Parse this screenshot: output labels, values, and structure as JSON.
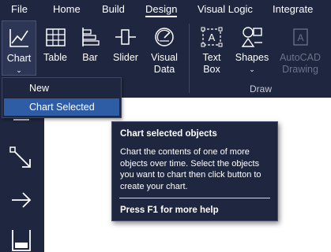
{
  "menu": {
    "tabs": [
      {
        "label": "File"
      },
      {
        "label": "Home"
      },
      {
        "label": "Build"
      },
      {
        "label": "Design",
        "active": true
      },
      {
        "label": "Visual Logic"
      },
      {
        "label": "Integrate"
      }
    ]
  },
  "ribbon": {
    "buttons": {
      "chart": "Chart",
      "table": "Table",
      "bar": "Bar",
      "slider": "Slider",
      "visual_data_line1": "Visual",
      "visual_data_line2": "Data",
      "text_box_line1": "Text",
      "text_box_line2": "Box",
      "shapes": "Shapes",
      "autocad_line1": "AutoCAD",
      "autocad_line2": "Drawing"
    },
    "groups": {
      "draw": "Draw"
    }
  },
  "dropdown": {
    "items": [
      {
        "label": "New"
      },
      {
        "label": "Chart Selected",
        "active": true
      }
    ]
  },
  "tooltip": {
    "title": "Chart selected objects",
    "body": "Chart the contents of one of more objects over time. Select the objects you want to chart then click button to create your chart.",
    "help": "Press F1 for more help"
  },
  "left_toolbar": {
    "icons": [
      "hamburger-icon",
      "resize-diagonal-icon",
      "arrow-right-icon",
      "container-icon"
    ]
  },
  "colors": {
    "ribbon_bg": "#1f2640",
    "selected_item": "#2e5da6",
    "disabled_text": "#6d7287",
    "canvas": "#ffffff"
  }
}
